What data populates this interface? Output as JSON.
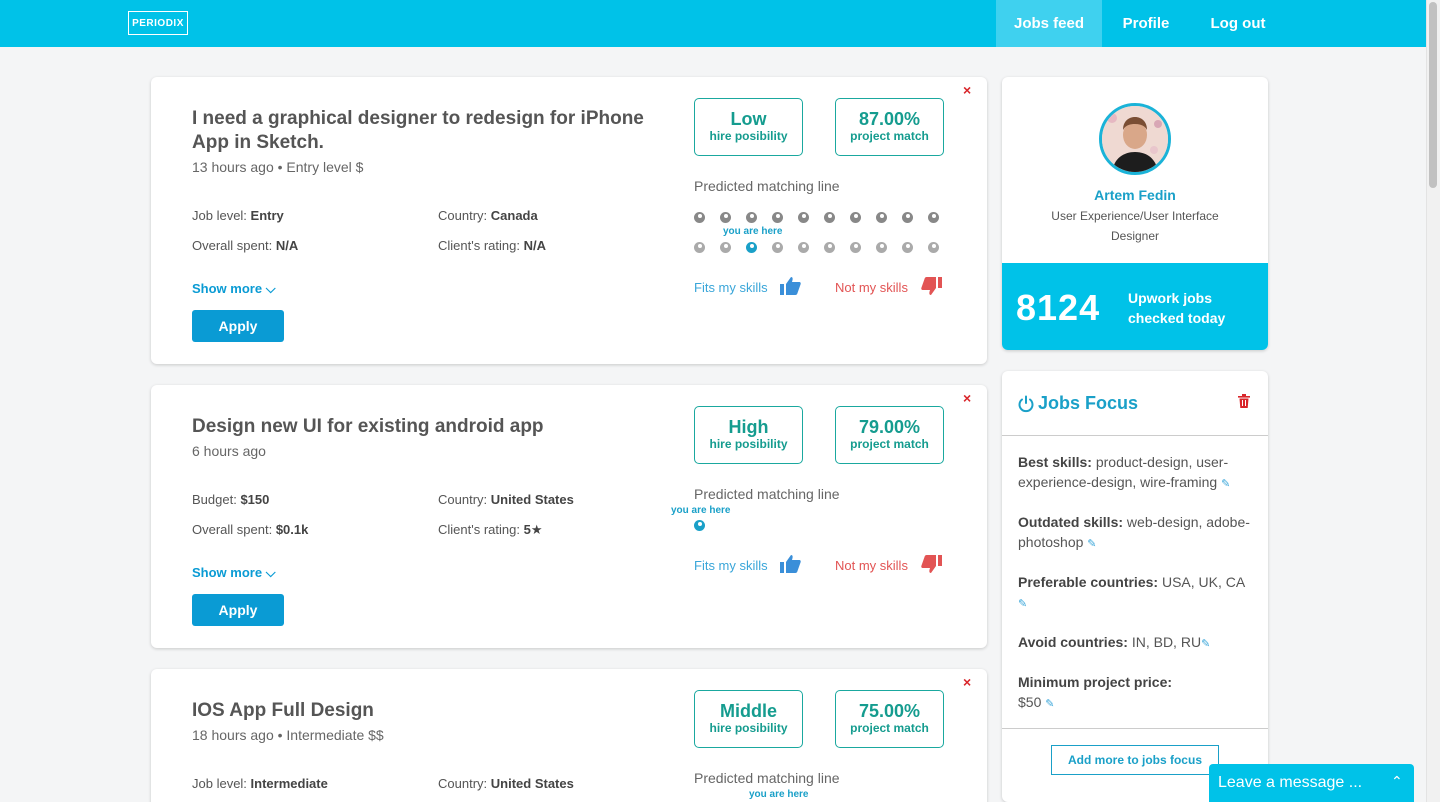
{
  "nav": {
    "logo": "PERIODIX",
    "jobs_feed": "Jobs feed",
    "profile": "Profile",
    "logout": "Log out"
  },
  "jobs": [
    {
      "title": "I need a graphical designer to redesign for iPhone App in Sketch.",
      "meta": "13 hours ago",
      "level_tag": "Entry level $",
      "info": [
        {
          "label": "Job level:",
          "value": "Entry"
        },
        {
          "label": "Country:",
          "value": "Canada"
        },
        {
          "label": "Overall spent:",
          "value": "N/A"
        },
        {
          "label": "Client's rating:",
          "value": "N/A"
        }
      ],
      "hire_level": "Low",
      "hire_label": "hire posibility",
      "match": "87.00%",
      "match_label": "project match"
    },
    {
      "title": "Design new UI for existing android app",
      "meta": "6 hours ago",
      "level_tag": "",
      "info": [
        {
          "label": "Budget:",
          "value": "$150"
        },
        {
          "label": "Country:",
          "value": "United States"
        },
        {
          "label": "Overall spent:",
          "value": "$0.1k"
        },
        {
          "label": "Client's rating:",
          "value": "5★"
        }
      ],
      "hire_level": "High",
      "hire_label": "hire posibility",
      "match": "79.00%",
      "match_label": "project match"
    },
    {
      "title": "IOS App Full Design",
      "meta": "18 hours ago",
      "level_tag": "Intermediate $$",
      "info": [
        {
          "label": "Job level:",
          "value": "Intermediate"
        },
        {
          "label": "Country:",
          "value": "United States"
        }
      ],
      "hire_level": "Middle",
      "hire_label": "hire posibility",
      "match": "75.00%",
      "match_label": "project match"
    }
  ],
  "labels": {
    "predicted_line": "Predicted matching line",
    "you_are_here": "you are here",
    "show_more": "Show more",
    "apply": "Apply",
    "fits": "Fits my skills",
    "not_fits": "Not my skills",
    "close": "×"
  },
  "profile": {
    "name": "Artem Fedin",
    "role": "User Experience/User Interface Designer",
    "jobs_count": "8124",
    "jobs_label": "Upwork jobs checked today"
  },
  "focus": {
    "title": "Jobs Focus",
    "best_label": "Best skills:",
    "best_value": "product-design, user-experience-design, wire-framing",
    "outdated_label": "Outdated skills:",
    "outdated_value": "web-design, adobe-photoshop",
    "pref_label": "Preferable countries:",
    "pref_value": "USA, UK, CA",
    "avoid_label": "Avoid countries:",
    "avoid_value": "IN, BD, RU",
    "min_label": "Minimum project price:",
    "min_value": "$50",
    "add_button": "Add more to jobs focus"
  },
  "chat": {
    "label": "Leave a message ..."
  },
  "icons": {
    "edit": "edit-icon",
    "thumbs_up": "thumbs-up-icon",
    "thumbs_down": "thumbs-down-icon",
    "power": "power-icon",
    "trash": "trash-icon",
    "chevron": "chevron-down-icon"
  },
  "colors": {
    "brand": "#00c2e8",
    "accent": "#0a9bd4",
    "badge": "#159c8f",
    "danger": "#d9252a"
  }
}
